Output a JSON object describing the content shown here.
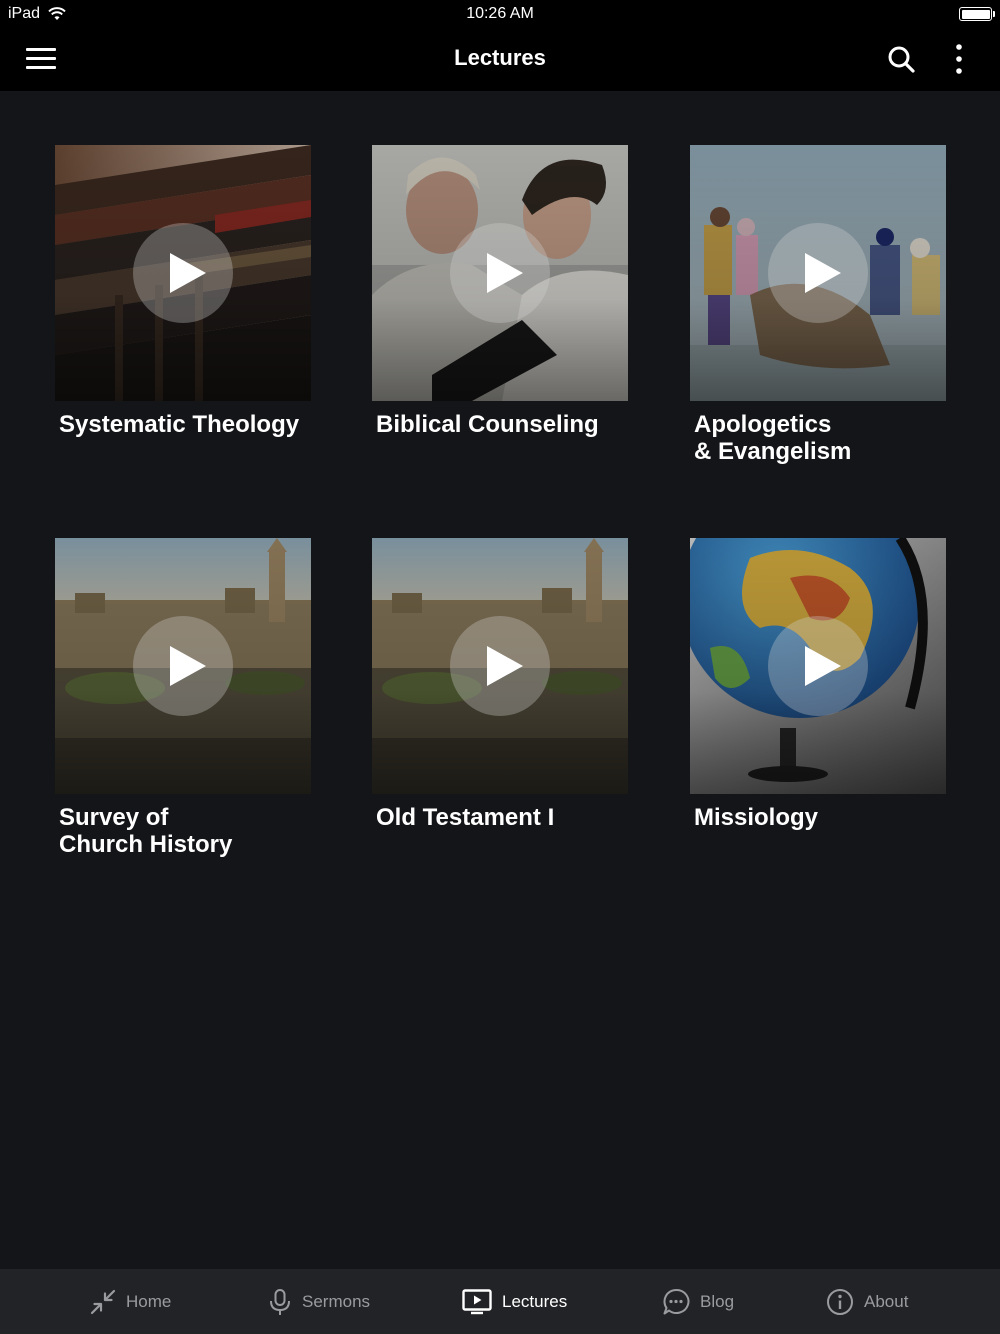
{
  "status_bar": {
    "device": "iPad",
    "time": "10:26 AM",
    "wifi_icon": "wifi-icon",
    "battery_icon": "battery-icon"
  },
  "app_bar": {
    "title": "Lectures",
    "menu_icon": "hamburger-menu-icon",
    "search_icon": "search-icon",
    "more_icon": "more-vertical-icon"
  },
  "lectures": [
    {
      "title": "Systematic Theology",
      "image": "stacked-old-books",
      "play_icon": "play-icon"
    },
    {
      "title": "Biblical Counseling",
      "image": "two-men-talking-with-bible",
      "play_icon": "play-icon"
    },
    {
      "title": "Apologetics\n& Evangelism",
      "image": "fishermen-pulling-net-on-beach",
      "play_icon": "play-icon"
    },
    {
      "title": "Survey of\nChurch History",
      "image": "jerusalem-citadel-tower",
      "play_icon": "play-icon"
    },
    {
      "title": "Old Testament I",
      "image": "jerusalem-citadel-tower",
      "play_icon": "play-icon"
    },
    {
      "title": "Missiology",
      "image": "world-globe",
      "play_icon": "play-icon"
    }
  ],
  "tab_bar": {
    "active": "Lectures",
    "tabs": [
      {
        "label": "Home",
        "icon": "minimize-arrows-icon"
      },
      {
        "label": "Sermons",
        "icon": "microphone-icon"
      },
      {
        "label": "Lectures",
        "icon": "video-play-icon"
      },
      {
        "label": "Blog",
        "icon": "chat-bubble-icon"
      },
      {
        "label": "About",
        "icon": "info-circle-icon"
      }
    ]
  },
  "colors": {
    "background": "#141518",
    "app_bar": "#000000",
    "tab_bar": "#222326",
    "tab_inactive": "#9a9b9f",
    "tab_active": "#ffffff"
  }
}
